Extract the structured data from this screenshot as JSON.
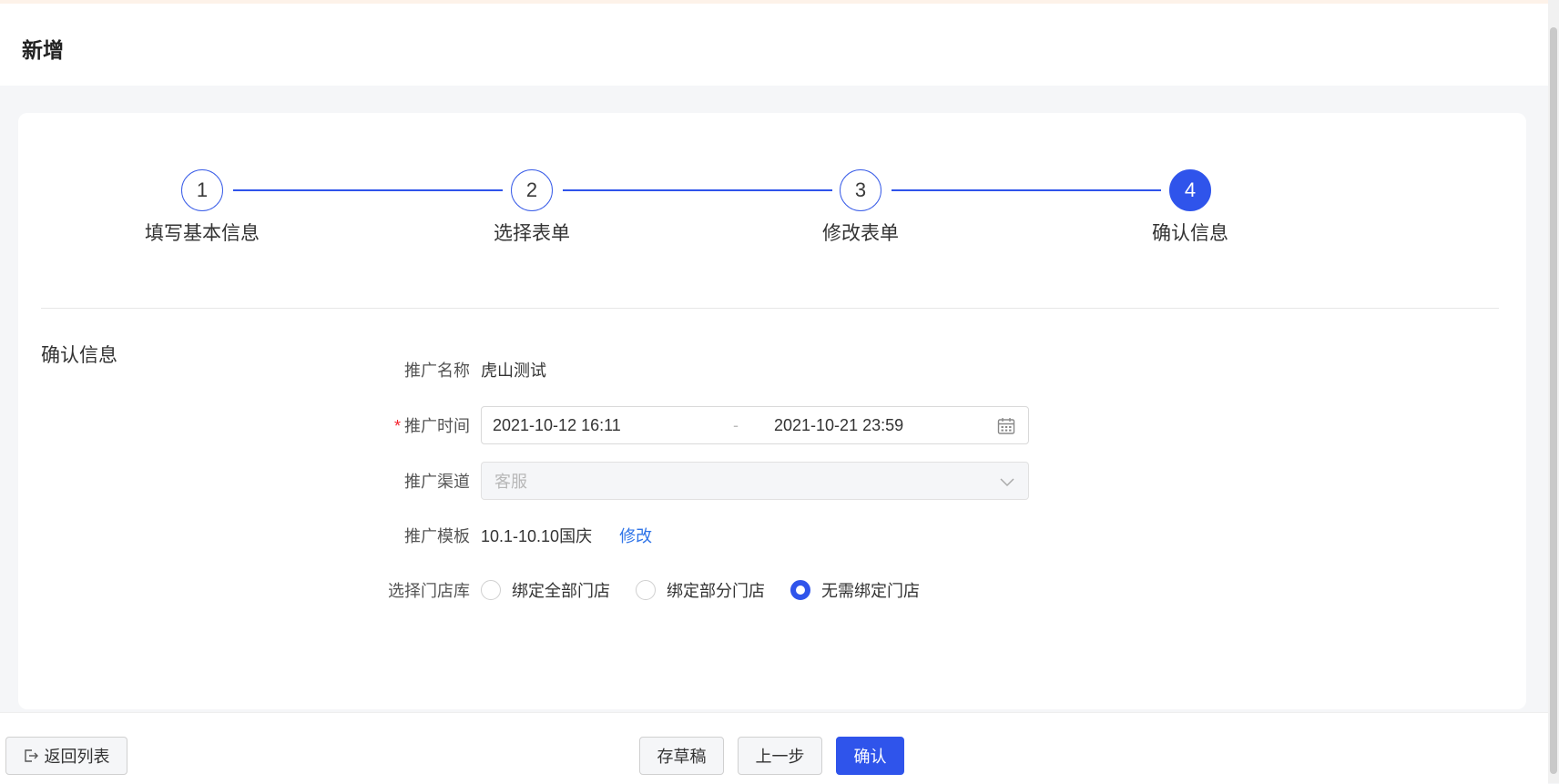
{
  "header": {
    "title": "新增"
  },
  "steps": [
    {
      "number": "1",
      "label": "填写基本信息"
    },
    {
      "number": "2",
      "label": "选择表单"
    },
    {
      "number": "3",
      "label": "修改表单"
    },
    {
      "number": "4",
      "label": "确认信息"
    }
  ],
  "section": {
    "title": "确认信息"
  },
  "form": {
    "name": {
      "label": "推广名称",
      "value": "虎山测试"
    },
    "time": {
      "required_mark": "*",
      "label": "推广时间",
      "start": "2021-10-12 16:11",
      "separator": "-",
      "end": "2021-10-21 23:59"
    },
    "channel": {
      "label": "推广渠道",
      "value": "客服"
    },
    "template": {
      "label": "推广模板",
      "value": "10.1-10.10国庆",
      "edit_label": "修改"
    },
    "store": {
      "label": "选择门店库",
      "options": [
        "绑定全部门店",
        "绑定部分门店",
        "无需绑定门店"
      ],
      "selected": "无需绑定门店"
    }
  },
  "footer": {
    "back_label": "返回列表",
    "draft_label": "存草稿",
    "prev_label": "上一步",
    "confirm_label": "确认"
  },
  "colors": {
    "primary": "#2f54eb",
    "link": "#2f74e8",
    "required": "#f5222d"
  }
}
